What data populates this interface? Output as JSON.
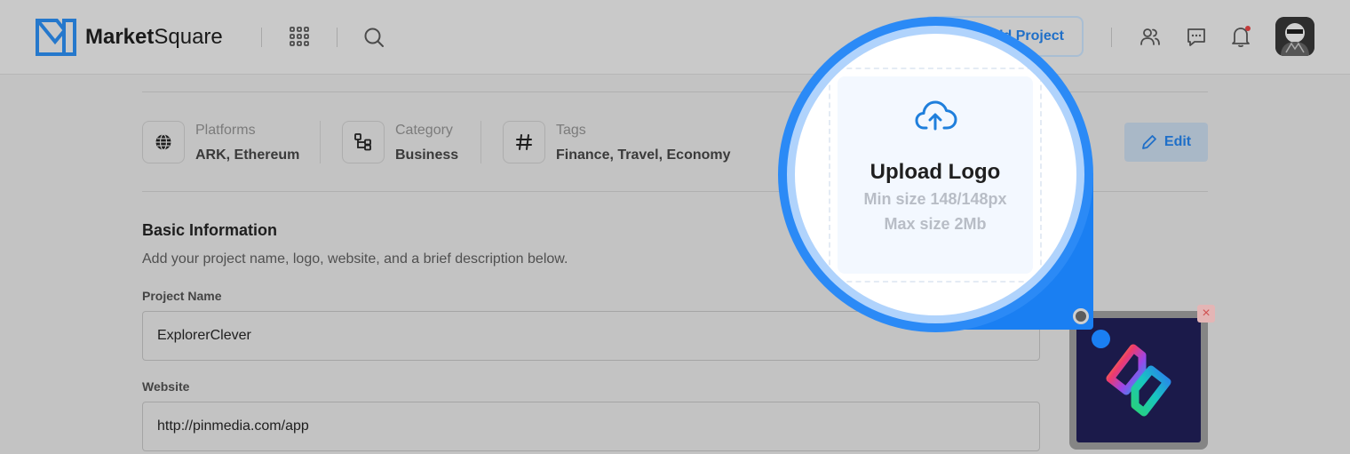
{
  "header": {
    "brand_part1": "Market",
    "brand_part2": "Square",
    "add_project_label": "Add Project"
  },
  "meta": {
    "platforms": {
      "label": "Platforms",
      "value": "ARK, Ethereum"
    },
    "category": {
      "label": "Category",
      "value": "Business"
    },
    "tags": {
      "label": "Tags",
      "value": "Finance, Travel, Economy"
    },
    "edit_label": "Edit"
  },
  "basic_info": {
    "title": "Basic Information",
    "description": "Add your project name, logo, website, and a brief description below.",
    "project_name_label": "Project Name",
    "project_name_value": "ExplorerClever",
    "website_label": "Website",
    "website_value": "http://pinmedia.com/app"
  },
  "upload": {
    "title": "Upload Logo",
    "min_size": "Min size 148/148px",
    "max_size": "Max size 2Mb"
  },
  "remove_glyph": "×",
  "colors": {
    "accent": "#1f6fc8",
    "magnifier": "#2b8af6"
  },
  "icons": [
    "grid-icon",
    "search-icon",
    "users-icon",
    "chat-icon",
    "bell-icon",
    "globe-icon",
    "category-icon",
    "hash-icon",
    "pencil-icon",
    "cloud-upload-icon",
    "close-icon"
  ]
}
